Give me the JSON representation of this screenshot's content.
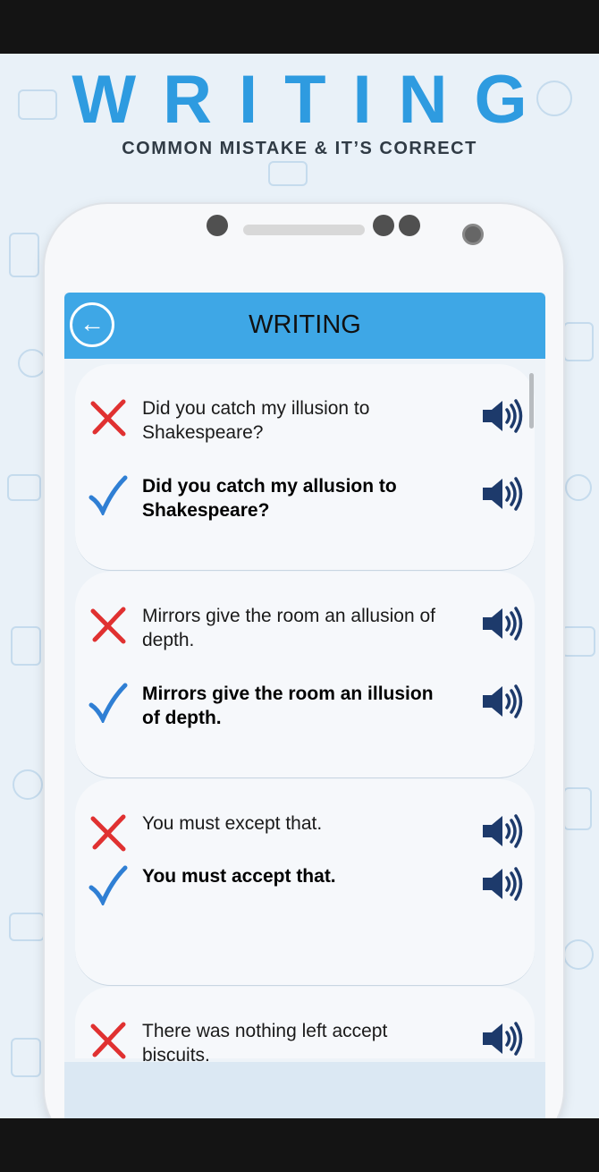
{
  "banner": {
    "title": "WRITING",
    "subtitle": "COMMON MISTAKE & IT’S CORRECT"
  },
  "app": {
    "title": "WRITING",
    "back_icon": "arrow-left-circle-icon"
  },
  "colors": {
    "accent": "#3ea7e6",
    "wrong": "#e03131",
    "right": "#2f7fd4",
    "speaker": "#1d3a6b"
  },
  "items": [
    {
      "wrong": "Did you catch my illusion to Shakespeare?",
      "correct": "Did you catch my allusion to Shakespeare?"
    },
    {
      "wrong": "Mirrors give the room an allusion of depth.",
      "correct": "Mirrors give the room an illusion of depth."
    },
    {
      "wrong": "You must except that.",
      "correct": "You must accept that."
    },
    {
      "wrong": "There was nothing left accept biscuits."
    }
  ]
}
